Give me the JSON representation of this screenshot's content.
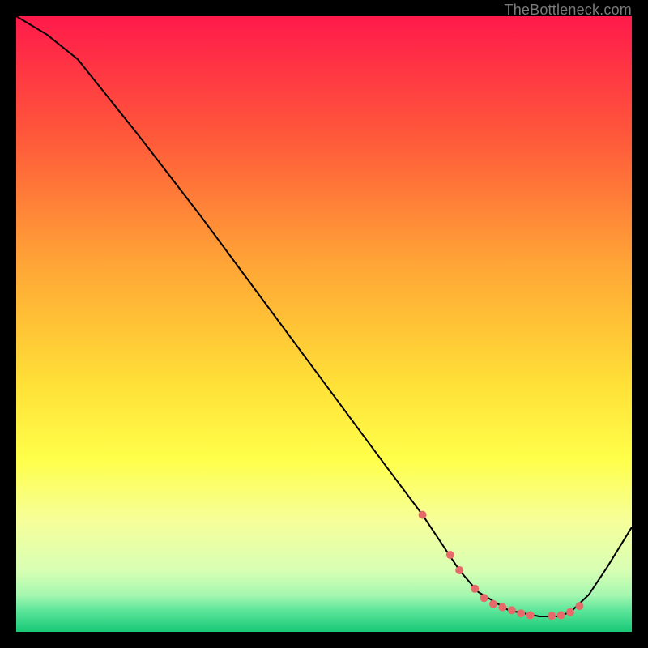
{
  "watermark": "TheBottleneck.com",
  "chart_data": {
    "type": "line",
    "title": "",
    "xlabel": "",
    "ylabel": "",
    "xlim": [
      0,
      100
    ],
    "ylim": [
      0,
      100
    ],
    "background_gradient": {
      "stops": [
        {
          "offset": 0.0,
          "color": "#ff1a4b"
        },
        {
          "offset": 0.2,
          "color": "#ff5a3a"
        },
        {
          "offset": 0.4,
          "color": "#ffa436"
        },
        {
          "offset": 0.6,
          "color": "#ffe137"
        },
        {
          "offset": 0.72,
          "color": "#ffff4a"
        },
        {
          "offset": 0.82,
          "color": "#f6ff9a"
        },
        {
          "offset": 0.9,
          "color": "#d8ffb4"
        },
        {
          "offset": 0.94,
          "color": "#a6f7b0"
        },
        {
          "offset": 0.965,
          "color": "#5de69a"
        },
        {
          "offset": 1.0,
          "color": "#18c877"
        }
      ]
    },
    "series": [
      {
        "name": "bottleneck-curve",
        "color": "#000000",
        "x": [
          0,
          5,
          10,
          20,
          30,
          40,
          50,
          60,
          66,
          70,
          72,
          75,
          80,
          85,
          88,
          90,
          93,
          96,
          100
        ],
        "y": [
          100,
          97,
          93,
          80.5,
          67.5,
          54,
          40.5,
          27,
          19,
          13,
          10,
          6.5,
          3.5,
          2.5,
          2.5,
          3.2,
          6,
          10.5,
          17
        ]
      }
    ],
    "markers": {
      "name": "highlight-points",
      "color": "#e76a6a",
      "x": [
        66,
        70.5,
        72,
        74.5,
        76,
        77.5,
        79,
        80.5,
        82,
        83.5,
        87,
        88.5,
        90,
        91.5
      ],
      "y": [
        19,
        12.5,
        10,
        7,
        5.5,
        4.5,
        4,
        3.5,
        3,
        2.7,
        2.6,
        2.7,
        3.2,
        4.2
      ]
    }
  }
}
